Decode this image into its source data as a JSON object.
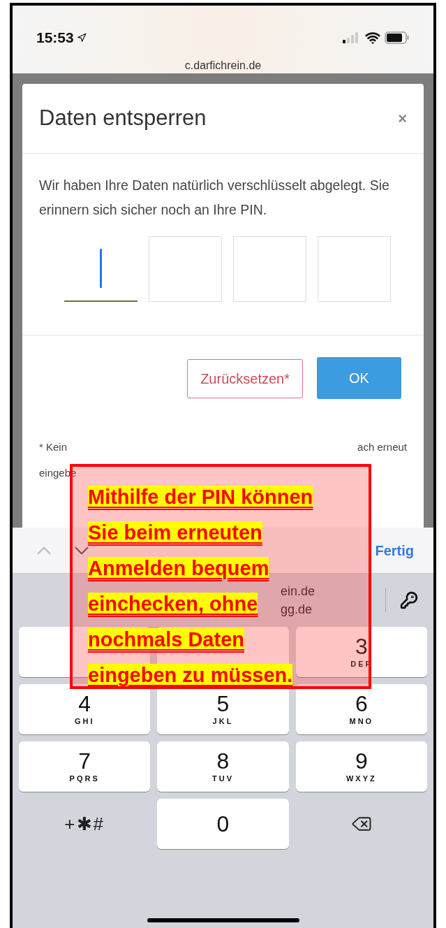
{
  "status_bar": {
    "time": "15:53"
  },
  "address_bar": {
    "url": "c.darfichrein.de"
  },
  "dialog": {
    "title": "Daten entsperren",
    "close": "×",
    "message": "Wir haben Ihre Daten natürlich verschlüsselt abgelegt. Sie erinnern sich sicher noch an Ihre PIN.",
    "pin_fields": [
      {
        "selected": true
      },
      {
        "selected": false
      },
      {
        "selected": false
      },
      {
        "selected": false
      }
    ],
    "buttons": [
      {
        "kind": "outline",
        "label": "Zurücksetzen*"
      },
      {
        "kind": "primary",
        "label": "OK"
      }
    ],
    "footnote_fragments": [
      {
        "kind": "left",
        "text": "* Kein"
      },
      {
        "kind": "right",
        "text": "ach erneut"
      },
      {
        "kind": "line2",
        "text": "eingebe"
      }
    ]
  },
  "keyboard": {
    "done": "Fertig",
    "suggestions": [
      "ein.de",
      "gg.de"
    ],
    "keys": [
      {
        "kind": "blank"
      },
      {
        "kind": "blank"
      },
      {
        "kind": "digit",
        "digit": "3",
        "letters": "DEF"
      },
      {
        "kind": "digit",
        "digit": "4",
        "letters": "GHI"
      },
      {
        "kind": "digit",
        "digit": "5",
        "letters": "JKL"
      },
      {
        "kind": "digit",
        "digit": "6",
        "letters": "MNO"
      },
      {
        "kind": "digit",
        "digit": "7",
        "letters": "PQRS"
      },
      {
        "kind": "digit",
        "digit": "8",
        "letters": "TUV"
      },
      {
        "kind": "digit",
        "digit": "9",
        "letters": "WXYZ"
      },
      {
        "kind": "symbols",
        "digit": "+✱#"
      },
      {
        "kind": "digit",
        "digit": "0"
      },
      {
        "kind": "delete"
      }
    ]
  },
  "annotation": {
    "text": "Mithilfe der PIN können Sie beim erneuten Anmelden bequem einchecken, ohne nochmals Daten eingeben zu müssen."
  }
}
